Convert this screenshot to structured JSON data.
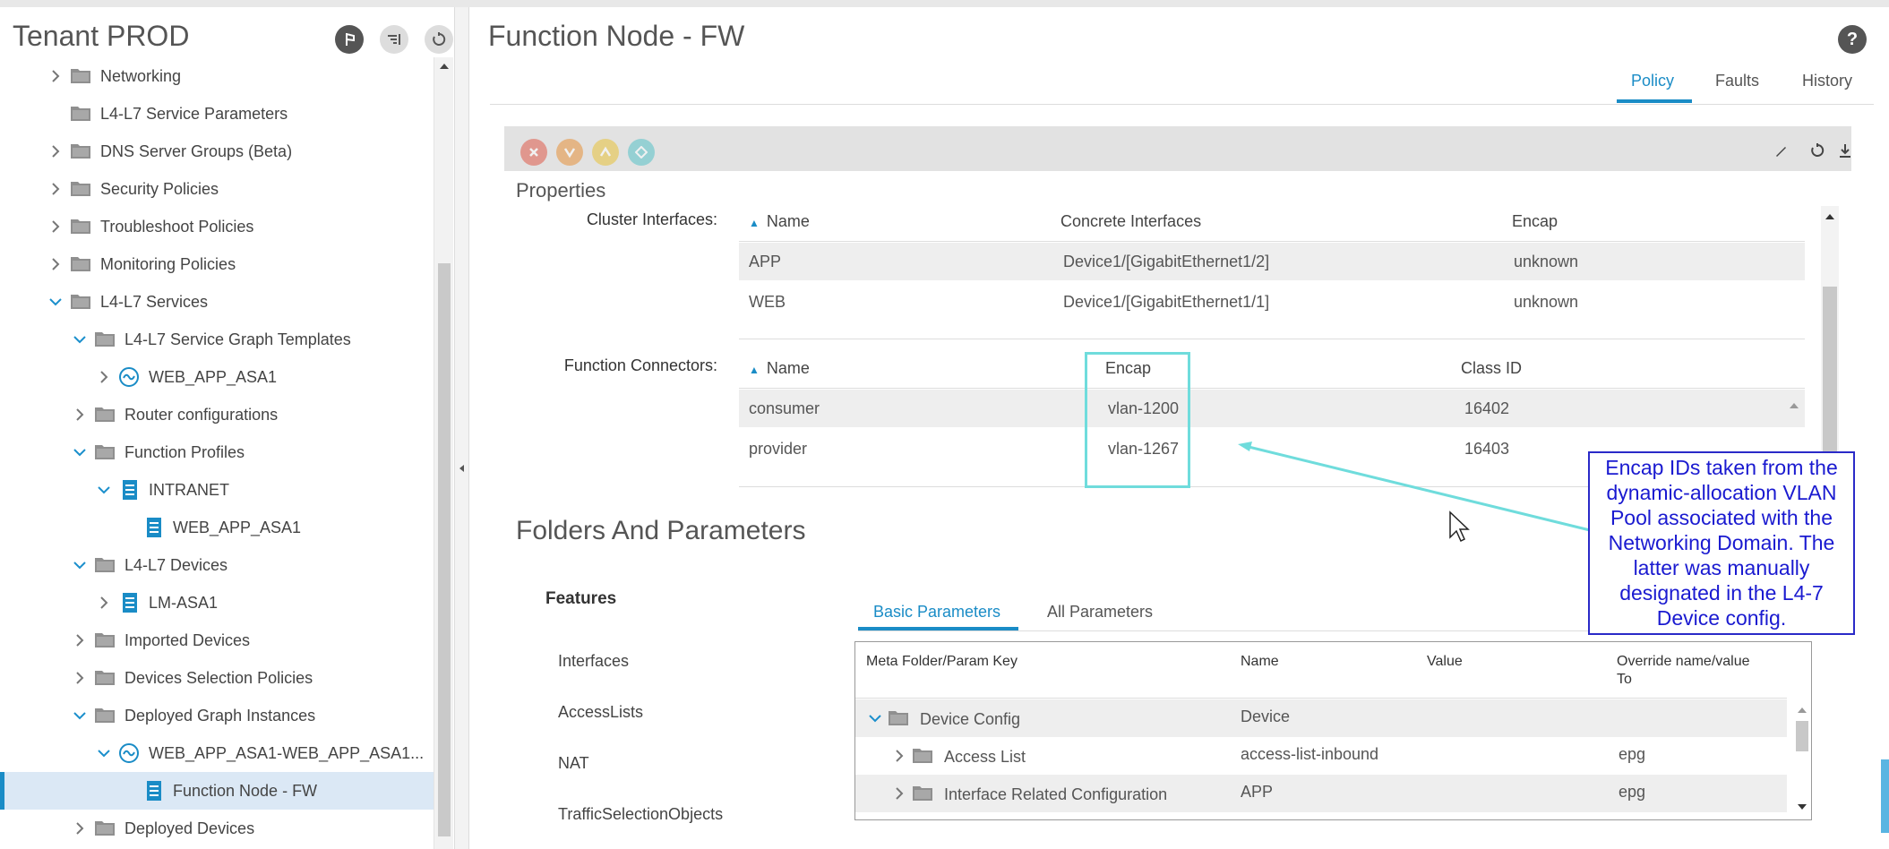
{
  "nav": {
    "title": "Tenant PROD",
    "items": [
      {
        "label": "Networking"
      },
      {
        "label": "L4-L7 Service Parameters"
      },
      {
        "label": "DNS Server Groups (Beta)"
      },
      {
        "label": "Security Policies"
      },
      {
        "label": "Troubleshoot Policies"
      },
      {
        "label": "Monitoring Policies"
      },
      {
        "label": "L4-L7 Services"
      },
      {
        "label": "L4-L7 Service Graph Templates"
      },
      {
        "label": "WEB_APP_ASA1"
      },
      {
        "label": "Router configurations"
      },
      {
        "label": "Function Profiles"
      },
      {
        "label": "INTRANET"
      },
      {
        "label": "WEB_APP_ASA1"
      },
      {
        "label": "L4-L7 Devices"
      },
      {
        "label": "LM-ASA1"
      },
      {
        "label": "Imported Devices"
      },
      {
        "label": "Devices Selection Policies"
      },
      {
        "label": "Deployed Graph Instances"
      },
      {
        "label": "WEB_APP_ASA1-WEB_APP_ASA1..."
      },
      {
        "label": "Function Node - FW"
      },
      {
        "label": "Deployed Devices"
      }
    ]
  },
  "main": {
    "title": "Function Node - FW",
    "help": "?",
    "tabs": [
      "Policy",
      "Faults",
      "History"
    ],
    "properties_heading": "Properties",
    "cluster_interfaces": {
      "label": "Cluster Interfaces:",
      "columns": [
        "Name",
        "Concrete Interfaces",
        "Encap"
      ],
      "rows": [
        [
          "APP",
          "Device1/[GigabitEthernet1/2]",
          "unknown"
        ],
        [
          "WEB",
          "Device1/[GigabitEthernet1/1]",
          "unknown"
        ]
      ]
    },
    "function_connectors": {
      "label": "Function Connectors:",
      "columns": [
        "Name",
        "Encap",
        "Class ID"
      ],
      "rows": [
        [
          "consumer",
          "vlan-1200",
          "16402"
        ],
        [
          "provider",
          "vlan-1267",
          "16403"
        ]
      ]
    },
    "folders_heading": "Folders And Parameters",
    "features_heading": "Features",
    "features": [
      "Interfaces",
      "AccessLists",
      "NAT",
      "TrafficSelectionObjects"
    ],
    "param_tabs": [
      "Basic Parameters",
      "All Parameters"
    ],
    "param_table": {
      "columns": [
        "Meta Folder/Param Key",
        "Name",
        "Value",
        "Override name/value",
        "To"
      ],
      "rows": [
        {
          "key": "Device Config",
          "name": "Device",
          "value": "",
          "override": ""
        },
        {
          "key": "Access List",
          "name": "access-list-inbound",
          "value": "",
          "override": "epg"
        },
        {
          "key": "Interface Related Configuration",
          "name": "APP",
          "value": "",
          "override": "epg"
        }
      ]
    }
  },
  "annotation": {
    "text": "Encap IDs taken from the dynamic-allocation VLAN Pool associated with the Networking Domain. The latter was manually designated in the L4-7 Device config."
  },
  "colors": {
    "accent": "#1a8cc6",
    "highlight_box": "#6fdcdc",
    "callout": "#1a1ad0",
    "fault_critical": "#e05a4a",
    "fault_major": "#e6923a",
    "fault_minor": "#e8c23a",
    "fault_warning": "#58c2c8"
  },
  "icons": [
    "folder-icon",
    "chevron-right-icon",
    "chevron-down-icon",
    "graph-template-icon",
    "document-icon",
    "pin-icon",
    "collapse-icon",
    "refresh-icon",
    "edit-icon",
    "download-icon",
    "help-icon",
    "mouse-cursor-icon"
  ]
}
